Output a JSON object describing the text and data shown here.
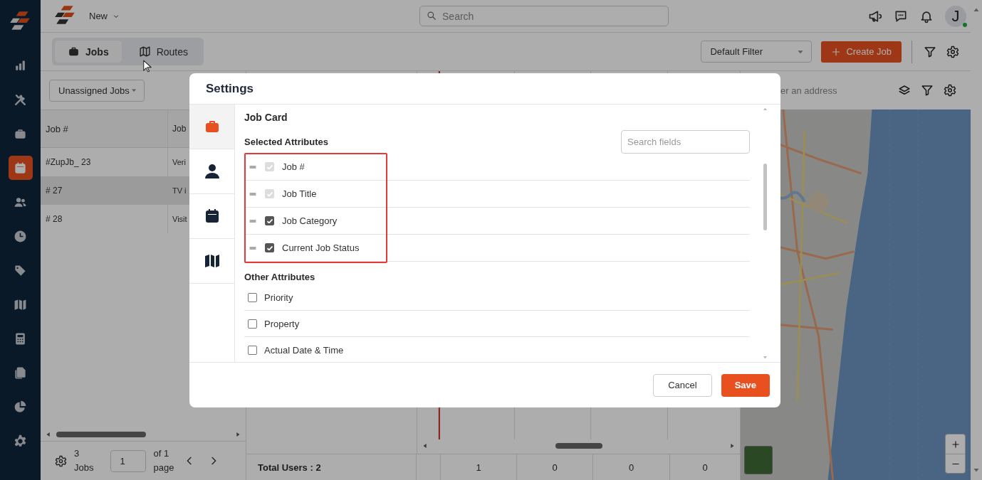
{
  "nav_items": [
    {
      "selected": false
    },
    {
      "selected": false
    },
    {
      "selected": false
    },
    {
      "selected": true
    },
    {
      "selected": false
    },
    {
      "selected": false
    },
    {
      "selected": false
    },
    {
      "selected": false
    },
    {
      "selected": false
    },
    {
      "selected": false
    },
    {
      "selected": false
    },
    {
      "selected": false
    }
  ],
  "header": {
    "menu_label": "New",
    "search_placeholder": "Search",
    "avatar_initial": "J",
    "online": true
  },
  "view_tabs": [
    {
      "label": "Jobs",
      "selected": true
    },
    {
      "label": "Routes",
      "selected": false
    }
  ],
  "toolbar": {
    "filter_select": "Default Filter",
    "create_button": "Create Job"
  },
  "jobs_panel": {
    "filter": "Unassigned Jobs",
    "columns": [
      "Job #",
      "Job"
    ],
    "rows": [
      {
        "cells": [
          "#ZupJb_ 23",
          "Veri"
        ],
        "selected": false
      },
      {
        "cells": [
          "# 27",
          "TV i"
        ],
        "selected": true
      },
      {
        "cells": [
          "# 28",
          "Visit"
        ],
        "selected": false
      }
    ],
    "count": "3",
    "count_label": "Jobs",
    "page": "1",
    "page_of": "of 1",
    "page_label": "page"
  },
  "schedule": {
    "total_users": "Total Users : 2",
    "counts": [
      "1",
      "0",
      "0",
      "0"
    ]
  },
  "map": {
    "address_placeholder": "er an address",
    "kind": "picture"
  },
  "modal": {
    "title": "Settings",
    "rail": [
      {
        "selected": true
      },
      {
        "selected": false
      },
      {
        "selected": false
      },
      {
        "selected": false
      }
    ],
    "section_title": "Job Card",
    "selected_heading": "Selected Attributes",
    "search_placeholder": "Search fields",
    "selected_highlight": true,
    "selected_attributes": [
      {
        "label": "Job #",
        "checked": true,
        "disabled": true
      },
      {
        "label": "Job Title",
        "checked": true,
        "disabled": true
      },
      {
        "label": "Job Category",
        "checked": true,
        "disabled": false
      },
      {
        "label": "Current Job Status",
        "checked": true,
        "disabled": false
      }
    ],
    "other_heading": "Other Attributes",
    "other_attributes": [
      {
        "label": "Priority",
        "checked": false
      },
      {
        "label": "Property",
        "checked": false
      },
      {
        "label": "Actual Date & Time",
        "checked": false
      }
    ],
    "cancel": "Cancel",
    "save": "Save"
  }
}
